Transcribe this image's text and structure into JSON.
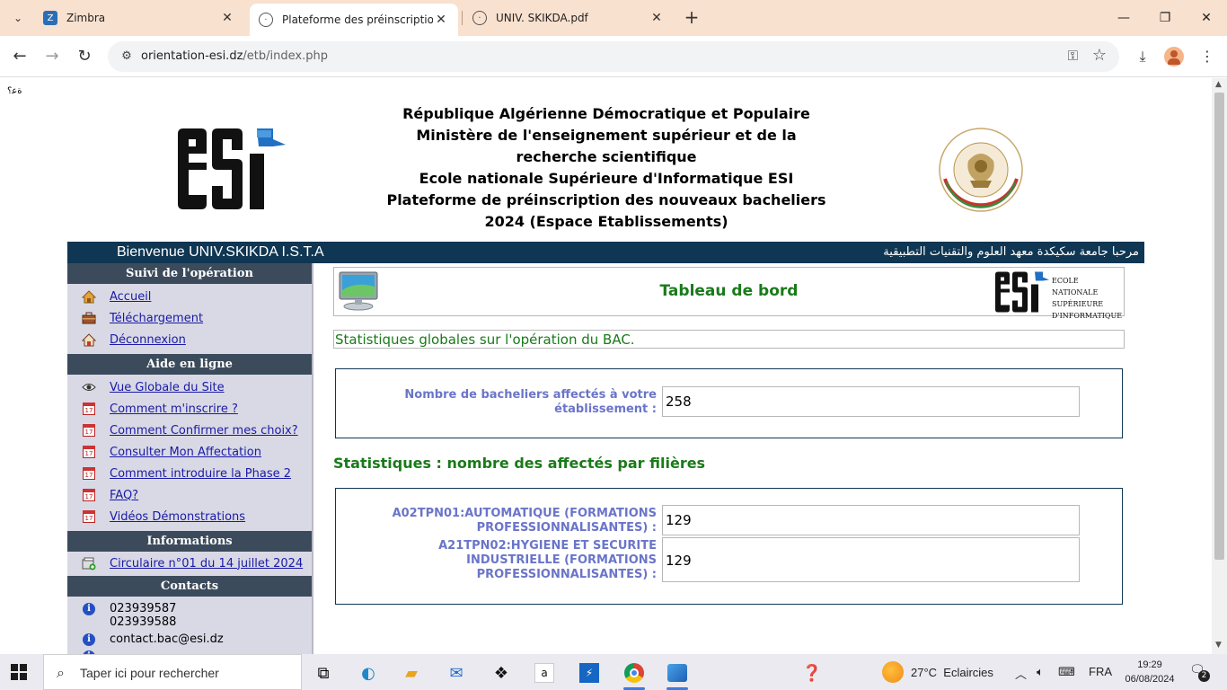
{
  "browser": {
    "tabs": [
      {
        "label": "Zimbra",
        "icon": "zimbra-icon"
      },
      {
        "label": "Plateforme des préinscriptions",
        "icon": "globe-icon"
      },
      {
        "label": "UNIV. SKIKDA.pdf",
        "icon": "globe-icon"
      }
    ],
    "url_host": "orientation-esi.dz",
    "url_path": "/etb/index.php"
  },
  "page": {
    "tiny_text": "ﺓﻋ؟",
    "header_lines": [
      "République Algérienne Démocratique et Populaire",
      "Ministère de l'enseignement supérieur et de la",
      "recherche scientifique",
      "Ecole nationale Supérieure d'Informatique ESI",
      "Plateforme de préinscription des nouveaux bacheliers",
      "2024 (Espace Etablissements)"
    ],
    "banner_left": "Bienvenue UNIV.SKIKDA I.S.T.A",
    "banner_right": "مرحبا جامعة سكيكدة معهد العلوم والتقنيات التطبيقية",
    "sidebar": {
      "section1_title": "Suivi de l'opération",
      "section1_items": [
        "Accueil",
        "Téléchargement",
        "Déconnexion"
      ],
      "section2_title": "Aide en ligne",
      "section2_items": [
        "Vue Globale du Site",
        "Comment m'inscrire ?",
        "Comment Confirmer mes choix?",
        "Consulter Mon Affectation",
        "Comment introduire la Phase 2",
        "FAQ?",
        "Vidéos Démonstrations"
      ],
      "section3_title": "Informations",
      "section3_items": [
        "Circulaire n°01 du 14 juillet 2024"
      ],
      "section4_title": "Contacts",
      "phone1": "023939587",
      "phone2": "023939588",
      "email": "contact.bac@esi.dz"
    },
    "main": {
      "title": "Tableau de bord",
      "esi_small_lines": [
        "ECOLE NATIONALE",
        "SUPÉRIEURE",
        "D'INFORMATIQUE"
      ],
      "subtitle": "Statistiques globales sur l'opération du BAC.",
      "stat1_label": "Nombre de bacheliers affectés à votre établissement :",
      "stat1_value": "258",
      "section_title": "Statistiques : nombre des affectés par filières",
      "filiere1_label": "A02TPN01:AUTOMATIQUE (FORMATIONS PROFESSIONNALISANTES) :",
      "filiere1_value": "129",
      "filiere2_label": "A21TPN02:HYGIENE ET SECURITE INDUSTRIELLE (FORMATIONS PROFESSIONNALISANTES) :",
      "filiere2_value": "129"
    }
  },
  "taskbar": {
    "search_placeholder": "Taper ici pour rechercher",
    "weather_temp": "27°C",
    "weather_desc": "Eclaircies",
    "lang": "FRA",
    "time": "19:29",
    "date": "06/08/2024",
    "notifications": "2"
  },
  "colors": {
    "banner": "#0f3652",
    "sidebar_head": "#3c4b5c",
    "sidebar_bg": "#d9d9e6",
    "green": "#1a7a1a",
    "label_blue": "#6a75c9",
    "tabbar": "#f9e1cf"
  }
}
